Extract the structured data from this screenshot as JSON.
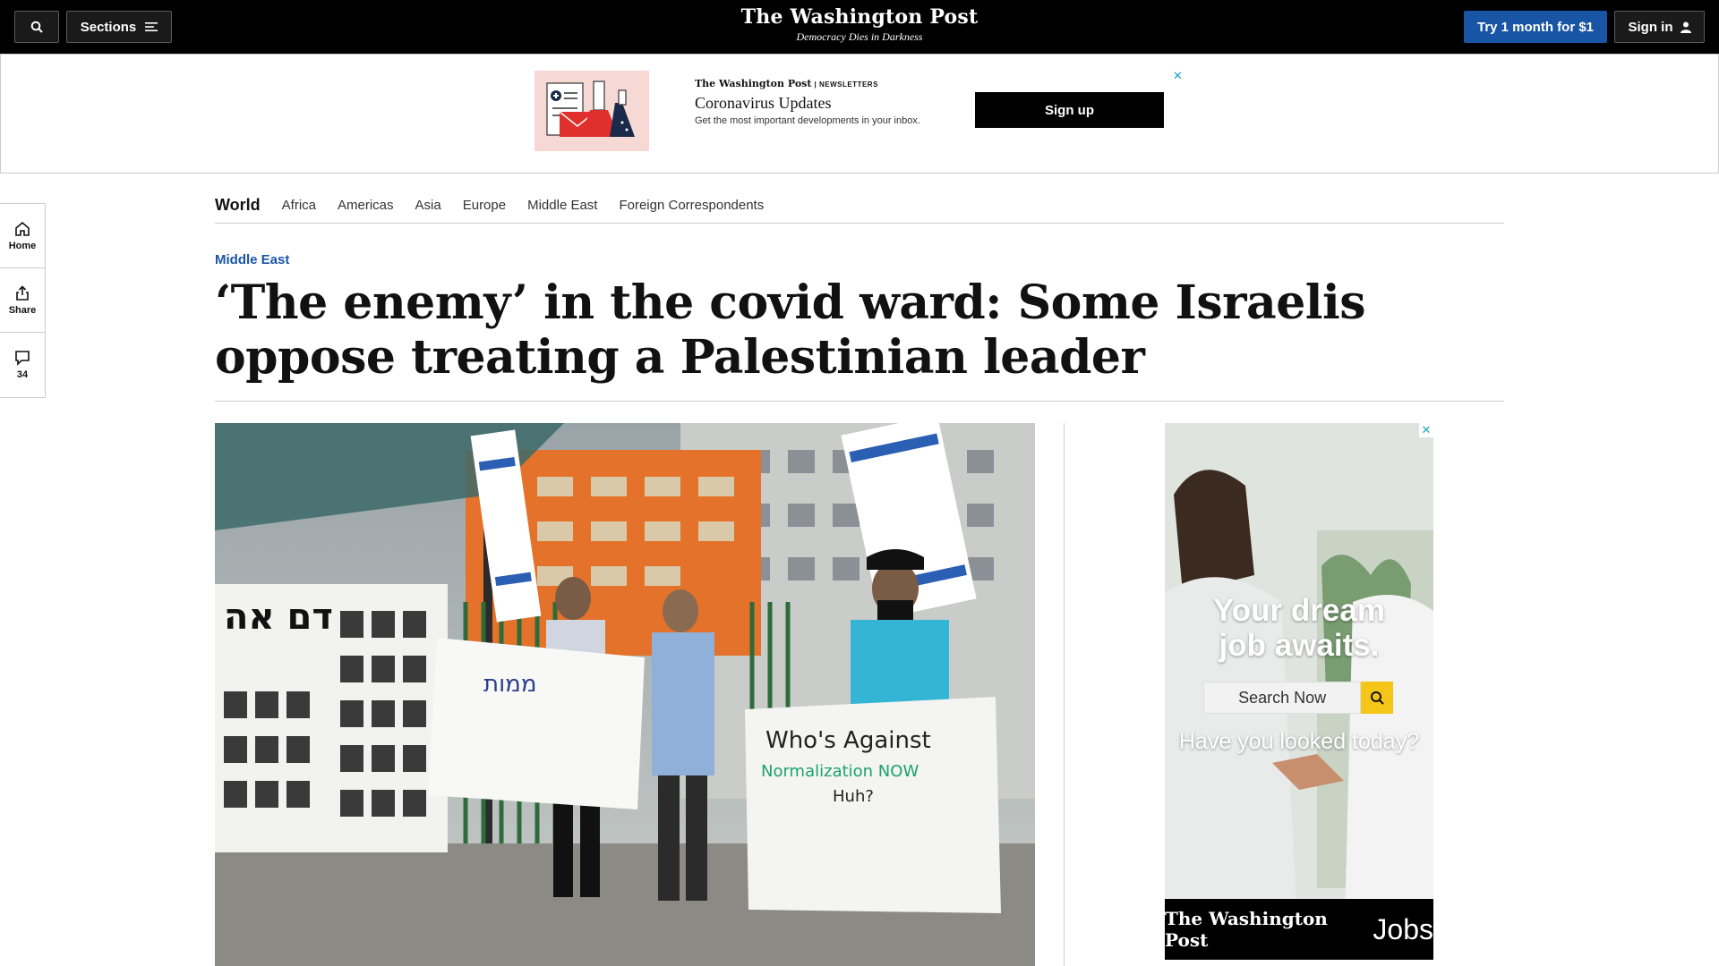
{
  "header": {
    "sections_label": "Sections",
    "logo": "The Washington Post",
    "tagline": "Democracy Dies in Darkness",
    "subscribe_label": "Try 1 month for $1",
    "signin_label": "Sign in"
  },
  "banner_ad": {
    "brand": "The Washington Post",
    "brand_suffix": "| NEWSLETTERS",
    "title": "Coronavirus Updates",
    "description": "Get the most important developments in your inbox.",
    "cta": "Sign up"
  },
  "rail": {
    "home_label": "Home",
    "share_label": "Share",
    "comments_count": "34"
  },
  "section_nav": {
    "title": "World",
    "links": [
      "Africa",
      "Americas",
      "Asia",
      "Europe",
      "Middle East",
      "Foreign Correspondents"
    ]
  },
  "article": {
    "kicker": "Middle East",
    "headline": "‘The enemy’ in the covid ward: Some Israelis oppose treating a Palestinian leader"
  },
  "photo": {
    "sign_left": "ממות",
    "sign_right_line1": "Who's Against",
    "sign_right_line2": "Normalization NOW",
    "sign_right_line3": "Huh?",
    "banner_text": "דם אה"
  },
  "jobs_ad": {
    "title_line1": "Your dream",
    "title_line2": "job awaits.",
    "search_label": "Search Now",
    "subtitle": "Have you looked today?",
    "footer_brand": "The Washington Post",
    "footer_label": "Jobs"
  },
  "colors": {
    "brand_blue": "#1955a5",
    "topbar": "#000000",
    "ad_close": "#1aa3c8",
    "jobs_search_button": "#f5c518"
  }
}
